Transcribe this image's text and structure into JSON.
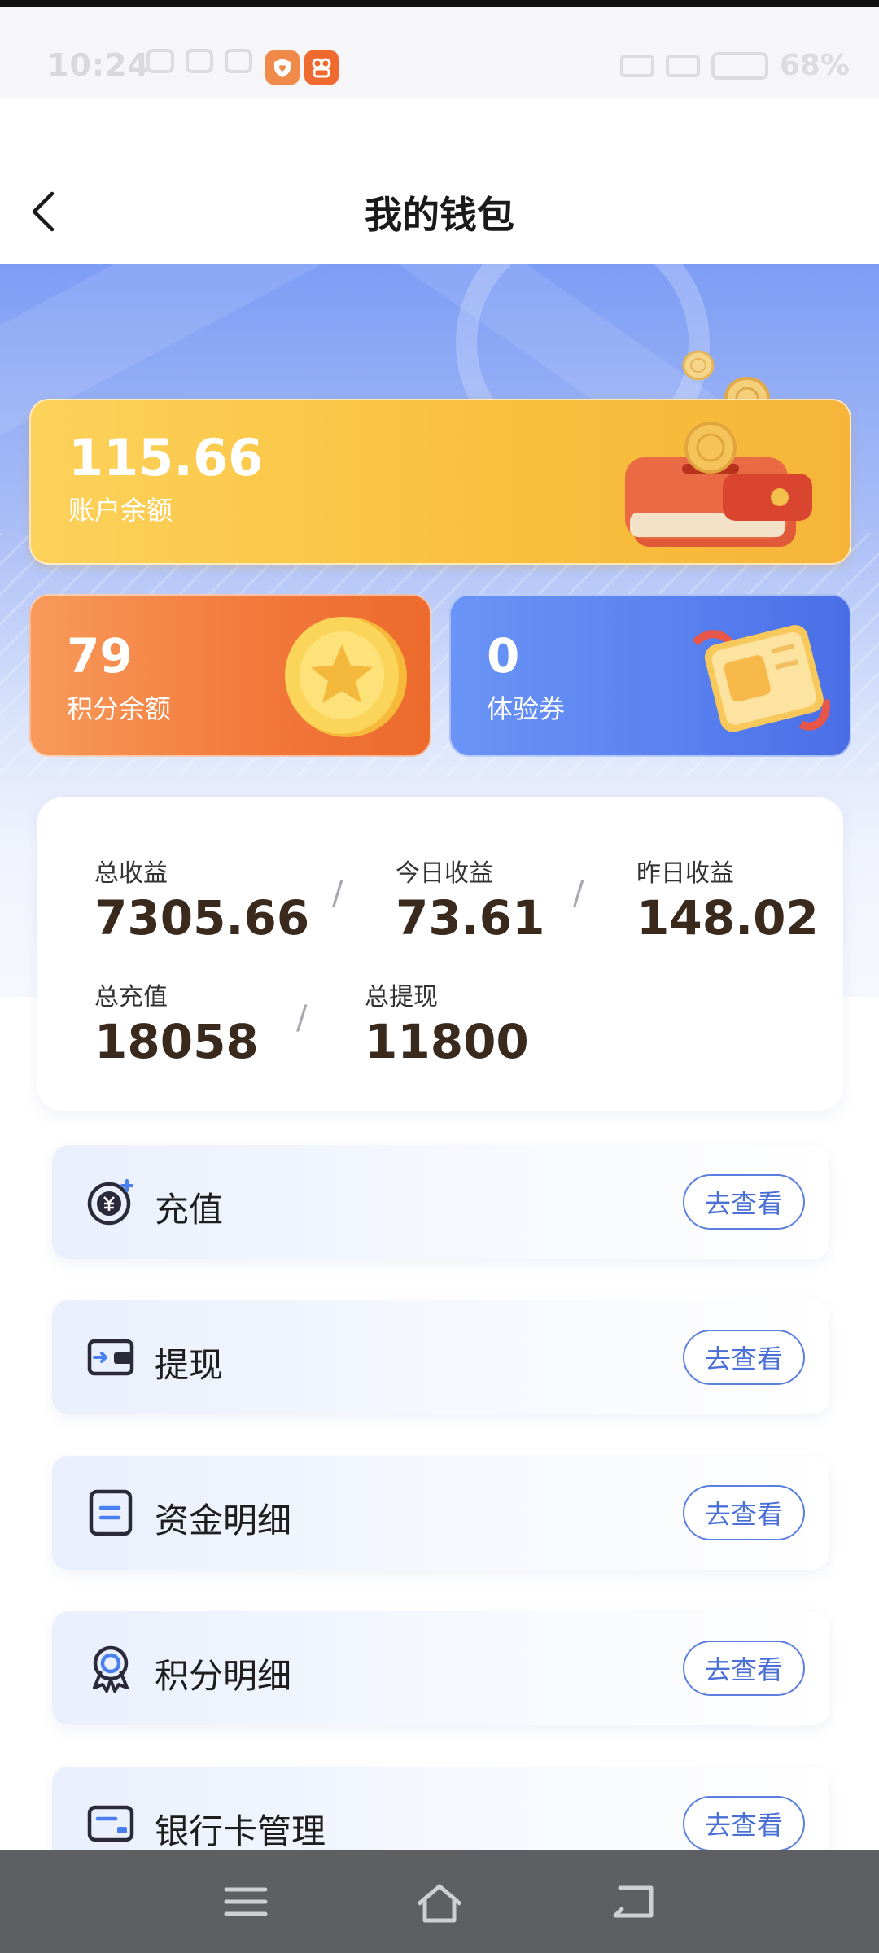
{
  "status_bar": {
    "time": "10:24",
    "battery": "68%"
  },
  "header": {
    "title": "我的钱包"
  },
  "balance_card": {
    "value": "115.66",
    "label": "账户余额"
  },
  "points_card": {
    "value": "79",
    "label": "积分余额"
  },
  "coupon_card": {
    "value": "0",
    "label": "体验券"
  },
  "stats": {
    "total_income": {
      "label": "总收益",
      "value": "7305.66"
    },
    "today_income": {
      "label": "今日收益",
      "value": "73.61"
    },
    "yesterday_income": {
      "label": "昨日收益",
      "value": "148.02"
    },
    "total_recharge": {
      "label": "总充值",
      "value": "18058"
    },
    "total_withdraw": {
      "label": "总提现",
      "value": "11800"
    },
    "separator": "/"
  },
  "menu": [
    {
      "label": "充值",
      "action": "去查看",
      "icon": "yuan-coin-icon"
    },
    {
      "label": "提现",
      "action": "去查看",
      "icon": "wallet-transfer-icon"
    },
    {
      "label": "资金明细",
      "action": "去查看",
      "icon": "document-icon"
    },
    {
      "label": "积分明细",
      "action": "去查看",
      "icon": "medal-icon"
    },
    {
      "label": "银行卡管理",
      "action": "去查看",
      "icon": "bank-card-icon"
    }
  ],
  "colors": {
    "accent_blue": "#4a6fd6",
    "balance_yellow": "#f9bf3c",
    "points_orange": "#f27a3c",
    "coupon_blue": "#5a82f0",
    "nav_bar": "#5e5f63"
  }
}
